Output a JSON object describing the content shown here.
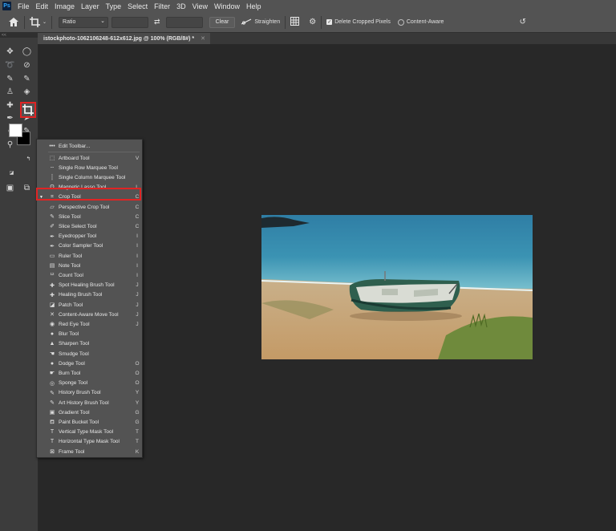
{
  "menubar": {
    "app_icon": "Ps",
    "items": [
      "File",
      "Edit",
      "Image",
      "Layer",
      "Type",
      "Select",
      "Filter",
      "3D",
      "View",
      "Window",
      "Help"
    ]
  },
  "options": {
    "ratio_label": "Ratio",
    "clear_label": "Clear",
    "straighten_label": "Straighten",
    "delete_cropped_label": "Delete Cropped Pixels",
    "content_aware_label": "Content-Aware"
  },
  "document": {
    "tab_title": "istockphoto-1062106248-612x612.jpg @ 100% (RGB/8#) *"
  },
  "toolbar": {
    "collapse": "<<"
  },
  "flyout": {
    "edit_toolbar": "Edit Toolbar...",
    "items": [
      {
        "label": "Artboard Tool",
        "key": "V",
        "icon": "artboard-icon",
        "glyph": "⬚"
      },
      {
        "label": "Single Row Marquee Tool",
        "key": "",
        "icon": "row-marquee-icon",
        "glyph": "┄"
      },
      {
        "label": "Single Column Marquee Tool",
        "key": "",
        "icon": "column-marquee-icon",
        "glyph": "┆"
      },
      {
        "label": "Magnetic Lasso Tool",
        "key": "L",
        "icon": "magnetic-lasso-icon",
        "glyph": "ʘ"
      },
      {
        "label": "Crop Tool",
        "key": "C",
        "icon": "crop-icon",
        "glyph": "⌗"
      },
      {
        "label": "Perspective Crop Tool",
        "key": "C",
        "icon": "perspective-crop-icon",
        "glyph": "▱"
      },
      {
        "label": "Slice Tool",
        "key": "C",
        "icon": "slice-icon",
        "glyph": "✎"
      },
      {
        "label": "Slice Select Tool",
        "key": "C",
        "icon": "slice-select-icon",
        "glyph": "✐"
      },
      {
        "label": "Eyedropper Tool",
        "key": "I",
        "icon": "eyedropper-icon",
        "glyph": "✒"
      },
      {
        "label": "Color Sampler Tool",
        "key": "I",
        "icon": "color-sampler-icon",
        "glyph": "✒"
      },
      {
        "label": "Ruler Tool",
        "key": "I",
        "icon": "ruler-icon",
        "glyph": "▭"
      },
      {
        "label": "Note Tool",
        "key": "I",
        "icon": "note-icon",
        "glyph": "▤"
      },
      {
        "label": "Count Tool",
        "key": "I",
        "icon": "count-icon",
        "glyph": "¹²"
      },
      {
        "label": "Spot Healing Brush Tool",
        "key": "J",
        "icon": "spot-healing-icon",
        "glyph": "✚"
      },
      {
        "label": "Healing Brush Tool",
        "key": "J",
        "icon": "healing-brush-icon",
        "glyph": "✚"
      },
      {
        "label": "Patch Tool",
        "key": "J",
        "icon": "patch-icon",
        "glyph": "◪"
      },
      {
        "label": "Content-Aware Move Tool",
        "key": "J",
        "icon": "content-aware-move-icon",
        "glyph": "✕"
      },
      {
        "label": "Red Eye Tool",
        "key": "J",
        "icon": "red-eye-icon",
        "glyph": "◉"
      },
      {
        "label": "Blur Tool",
        "key": "",
        "icon": "blur-icon",
        "glyph": "●"
      },
      {
        "label": "Sharpen Tool",
        "key": "",
        "icon": "sharpen-icon",
        "glyph": "▲"
      },
      {
        "label": "Smudge Tool",
        "key": "",
        "icon": "smudge-icon",
        "glyph": "☚"
      },
      {
        "label": "Dodge Tool",
        "key": "O",
        "icon": "dodge-icon",
        "glyph": "●"
      },
      {
        "label": "Burn Tool",
        "key": "O",
        "icon": "burn-icon",
        "glyph": "☛"
      },
      {
        "label": "Sponge Tool",
        "key": "O",
        "icon": "sponge-icon",
        "glyph": "◎"
      },
      {
        "label": "History Brush Tool",
        "key": "Y",
        "icon": "history-brush-icon",
        "glyph": "✎"
      },
      {
        "label": "Art History Brush Tool",
        "key": "Y",
        "icon": "art-history-brush-icon",
        "glyph": "✎"
      },
      {
        "label": "Gradient Tool",
        "key": "G",
        "icon": "gradient-icon",
        "glyph": "▣"
      },
      {
        "label": "Paint Bucket Tool",
        "key": "G",
        "icon": "paint-bucket-icon",
        "glyph": "⛾"
      },
      {
        "label": "Vertical Type Mask Tool",
        "key": "T",
        "icon": "vertical-type-mask-icon",
        "glyph": "T"
      },
      {
        "label": "Horizontal Type Mask Tool",
        "key": "T",
        "icon": "horizontal-type-mask-icon",
        "glyph": "T"
      },
      {
        "label": "Frame Tool",
        "key": "K",
        "icon": "frame-icon",
        "glyph": "⊠"
      }
    ]
  }
}
